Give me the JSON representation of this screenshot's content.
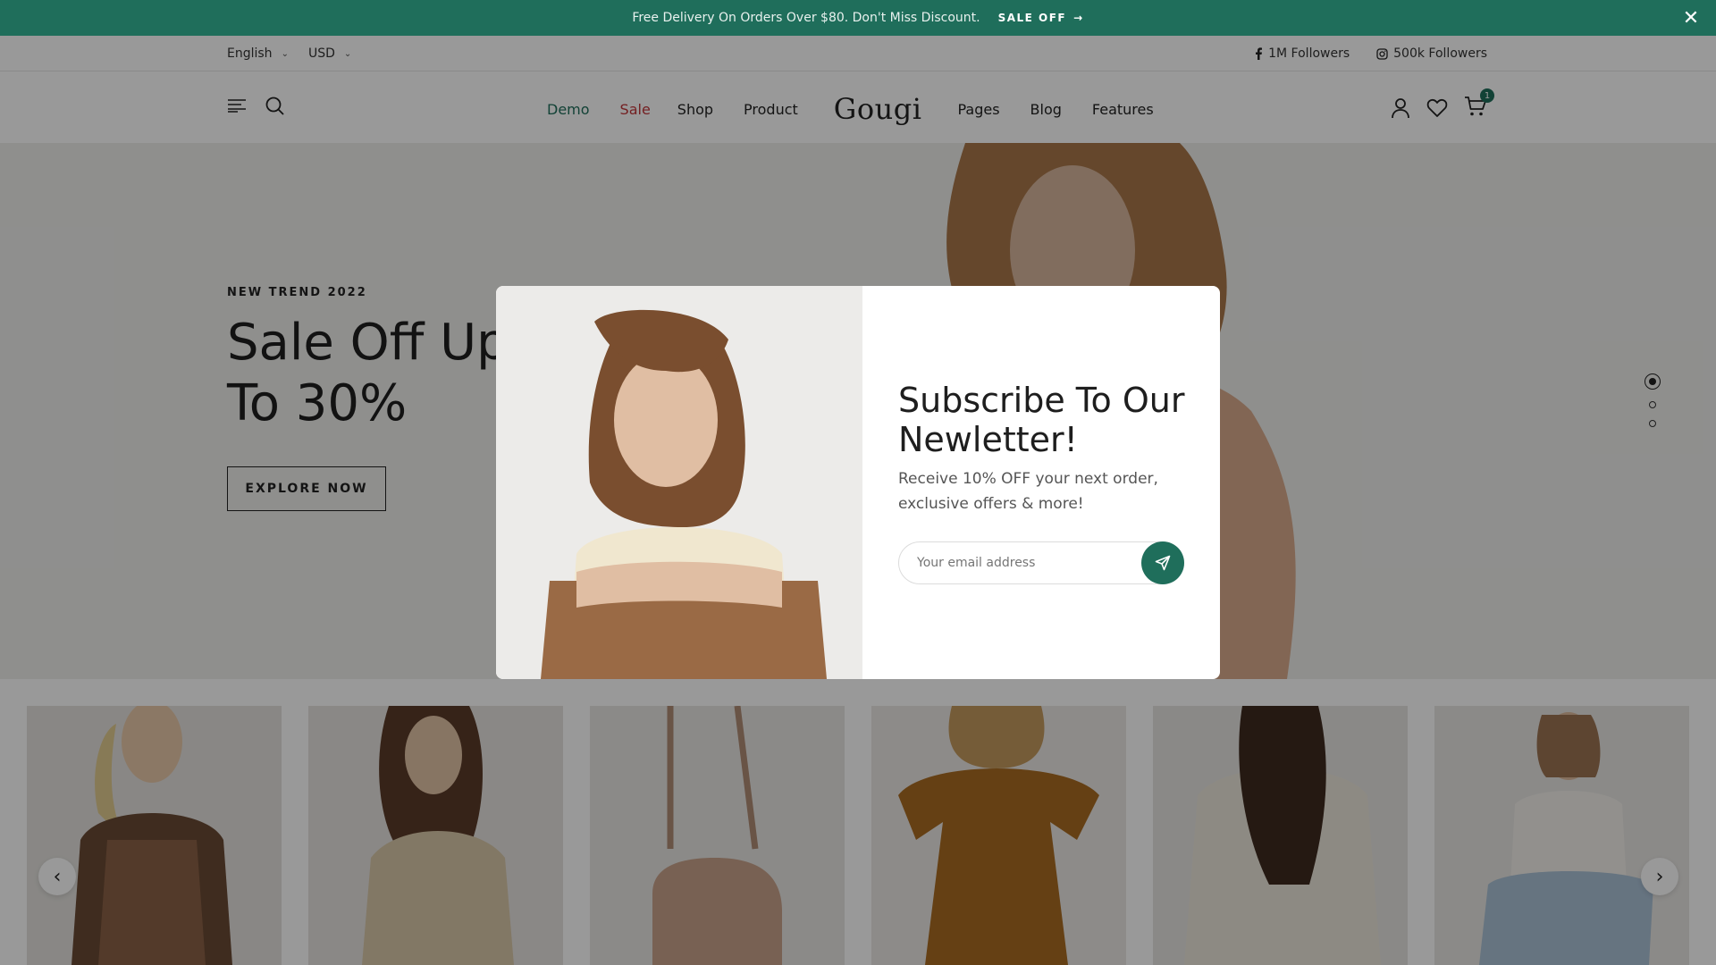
{
  "announcement": {
    "text": "Free Delivery On Orders Over $80. Don't Miss Discount.",
    "link": "SALE OFF",
    "close_icon": "close-icon"
  },
  "utility": {
    "language": "English",
    "currency": "USD",
    "facebook": "1M Followers",
    "instagram": "500k Followers"
  },
  "header": {
    "logo": "Gougi",
    "nav_left": [
      "Demo",
      "Sale",
      "Shop",
      "Product"
    ],
    "nav_right": [
      "Pages",
      "Blog",
      "Features"
    ],
    "cart_count": "1"
  },
  "hero": {
    "eyebrow": "NEW TREND 2022",
    "heading": "Sale Off Up To 30%",
    "button": "EXPLORE NOW"
  },
  "modal": {
    "title": "Subscribe To Our Newletter!",
    "description": "Receive 10% OFF your next order, exclusive offers & more!",
    "email_placeholder": "Your email address"
  },
  "colors": {
    "brand": "#1f6e5b",
    "sale": "#c2363a"
  }
}
